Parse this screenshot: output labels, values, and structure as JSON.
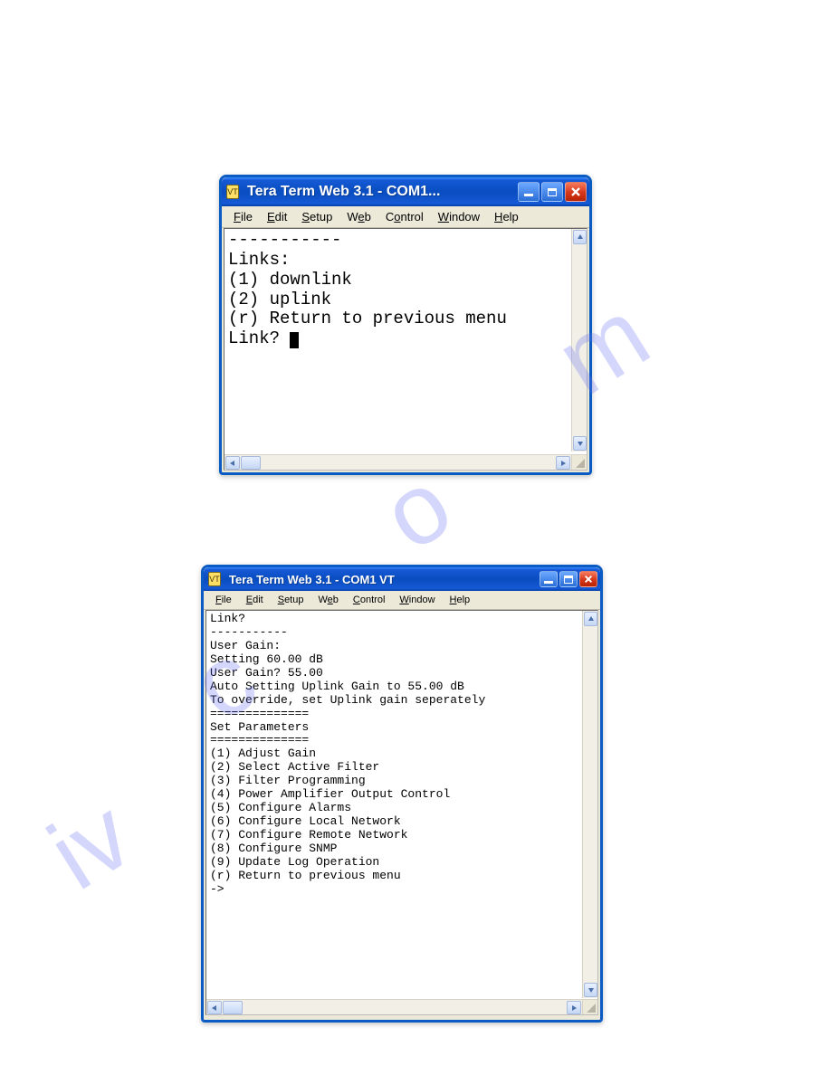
{
  "watermark": {
    "c1": "c",
    "c2": "o",
    "c3": "m",
    "prefix": "iv"
  },
  "windowA": {
    "title": "Tera Term Web 3.1 - COM1...",
    "appIconGlyph": "VT",
    "menu": {
      "file": "File",
      "file_u": "F",
      "edit": "Edit",
      "edit_u": "E",
      "setup": "Setup",
      "setup_u": "S",
      "web": "Web",
      "web_u": "e",
      "control": "Control",
      "control_u": "o",
      "window": "Window",
      "window_u": "W",
      "help": "Help",
      "help_u": "H",
      "file_rest": "ile",
      "edit_rest": "dit",
      "setup_rest": "etup",
      "web_pre": "W",
      "web_rest": "b",
      "control_pre": "C",
      "control_rest": "ntrol",
      "window_rest": "indow",
      "help_rest": "elp"
    },
    "terminal": {
      "sep": "-----------",
      "header": "Links:",
      "opt1": "(1) downlink",
      "opt2": "(2) uplink",
      "optr": "(r) Return to previous menu",
      "prompt": "Link? "
    }
  },
  "windowB": {
    "title": "Tera Term Web 3.1 - COM1 VT",
    "appIconGlyph": "VT",
    "menu": {
      "file_u": "F",
      "file_rest": "ile",
      "edit_u": "E",
      "edit_rest": "dit",
      "setup_u": "S",
      "setup_rest": "etup",
      "web_pre": "W",
      "web_u": "e",
      "web_rest": "b",
      "control_u": "C",
      "control_rest": "ontrol",
      "window_u": "W",
      "window_rest": "indow",
      "help_u": "H",
      "help_rest": "elp"
    },
    "terminal": {
      "l1": "Link?",
      "sep1": "-----------",
      "l2": "User Gain:",
      "l3": "Setting 60.00 dB",
      "l4": "User Gain? 55.00",
      "l5": "Auto Setting Uplink Gain to 55.00 dB",
      "l6": "To override, set Uplink gain seperately",
      "sep2": "==============",
      "l7": "Set Parameters",
      "sep3": "==============",
      "o1": "(1) Adjust Gain",
      "o2": "(2) Select Active Filter",
      "o3": "(3) Filter Programming",
      "o4": "(4) Power Amplifier Output Control",
      "o5": "(5) Configure Alarms",
      "o6": "(6) Configure Local Network",
      "o7": "(7) Configure Remote Network",
      "o8": "(8) Configure SNMP",
      "o9": "(9) Update Log Operation",
      "or": "(r) Return to previous menu",
      "prompt": "->"
    }
  }
}
